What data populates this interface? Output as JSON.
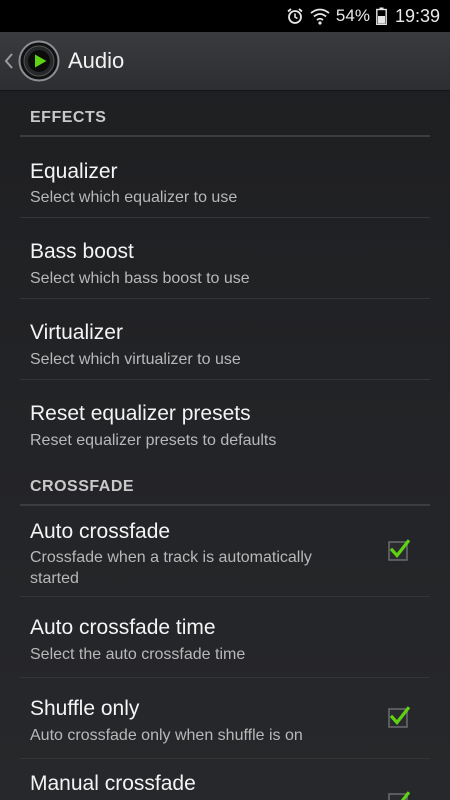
{
  "status_bar": {
    "icons": [
      "alarm-icon",
      "wifi-icon",
      "battery-icon"
    ],
    "battery_text": "54%",
    "time": "19:39"
  },
  "action_bar": {
    "title": "Audio",
    "back_icon": "chevron-left-icon",
    "logo_icon": "app-logo-icon"
  },
  "sections": {
    "effects": {
      "header": "EFFECTS",
      "items": [
        {
          "title": "Equalizer",
          "summary": "Select which equalizer to use"
        },
        {
          "title": "Bass boost",
          "summary": "Select which bass boost to use"
        },
        {
          "title": "Virtualizer",
          "summary": "Select which virtualizer to use"
        },
        {
          "title": "Reset equalizer presets",
          "summary": "Reset equalizer presets to defaults"
        }
      ]
    },
    "crossfade": {
      "header": "CROSSFADE",
      "items": [
        {
          "title": "Auto crossfade",
          "summary": "Crossfade when a track is automatically started",
          "checked": true
        },
        {
          "title": "Auto crossfade time",
          "summary": "Select the auto crossfade time"
        },
        {
          "title": "Shuffle only",
          "summary": "Auto crossfade only when shuffle is on",
          "checked": true
        },
        {
          "title": "Manual crossfade",
          "summary": "",
          "checked": true
        }
      ]
    }
  },
  "colors": {
    "accent_check": "#5fd313",
    "background": "#1b1c1e",
    "action_bar": "#333437"
  }
}
